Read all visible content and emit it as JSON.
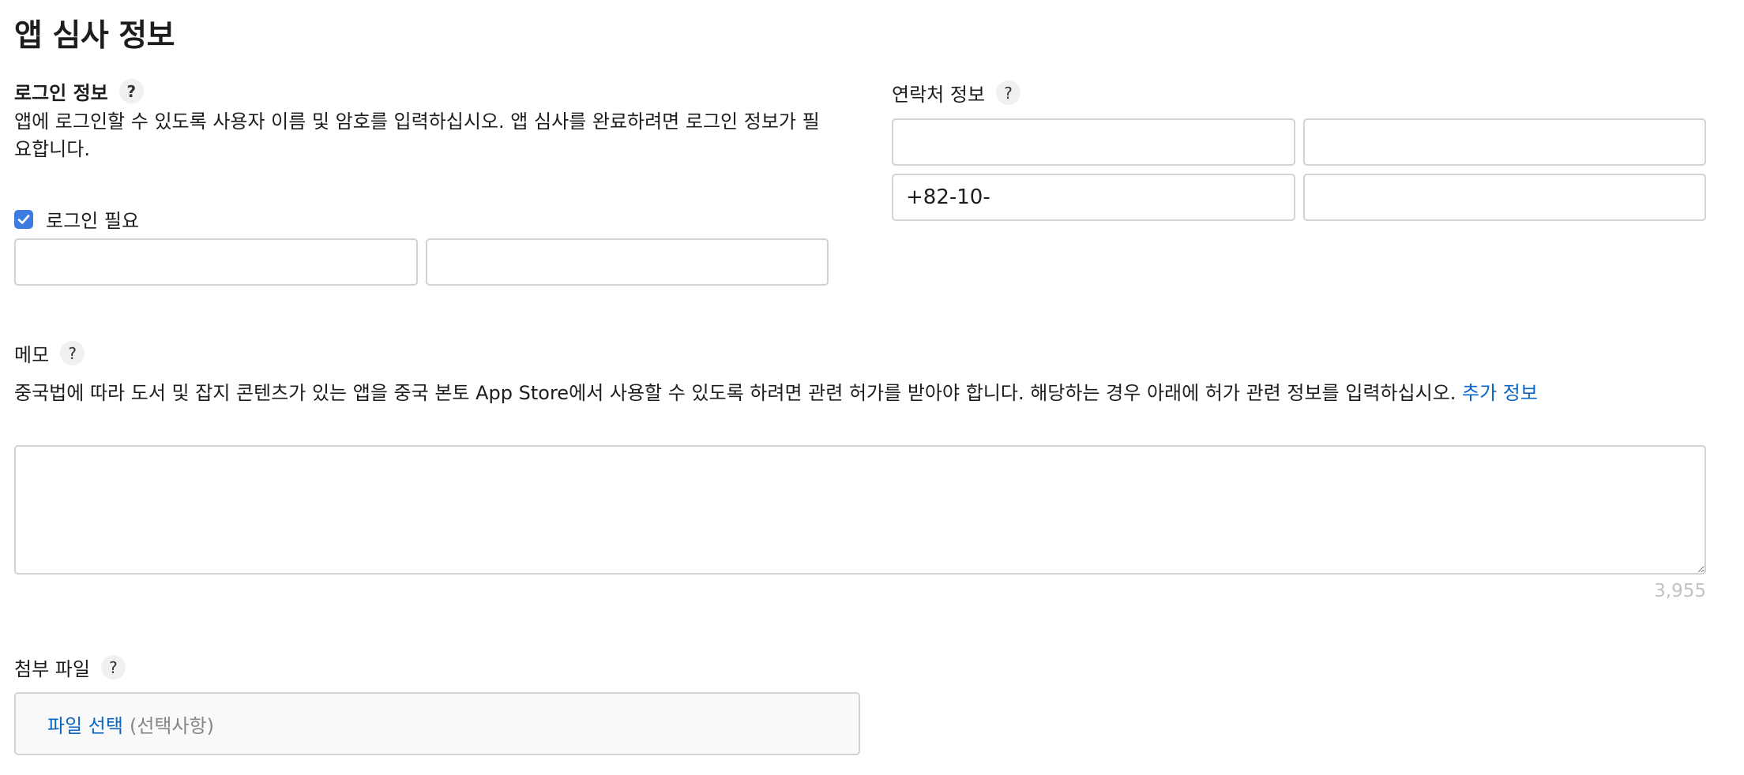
{
  "page": {
    "title": "앱 심사 정보"
  },
  "login_section": {
    "label": "로그인 정보",
    "help": "?",
    "description": "앱에 로그인할 수 있도록 사용자 이름 및 암호를 입력하십시오. 앱 심사를 완료하려면 로그인 정보가 필요합니다.",
    "checkbox_label": "로그인 필요",
    "checkbox_checked": true,
    "username_value": "",
    "password_value": ""
  },
  "contact_section": {
    "label": "연락처 정보",
    "help": "?",
    "first_name_value": "",
    "last_name_value": "",
    "phone_value": "+82-10-",
    "email_value": ""
  },
  "memo_section": {
    "label": "메모",
    "help": "?",
    "description": "중국법에 따라 도서 및 잡지 콘텐츠가 있는 앱을 중국 본토 App Store에서 사용할 수 있도록 하려면 관련 허가를 받아야 합니다. 해당하는 경우 아래에 허가 관련 정보를 입력하십시오.",
    "more_link": "추가 정보",
    "memo_value": "",
    "remaining_chars": "3,955"
  },
  "attachment_section": {
    "label": "첨부 파일",
    "help": "?",
    "choose_file": "파일 선택",
    "optional": "(선택사항)"
  },
  "colors": {
    "accent": "#3d7be0",
    "link": "#0a66c2",
    "border": "#d2d2d7"
  }
}
